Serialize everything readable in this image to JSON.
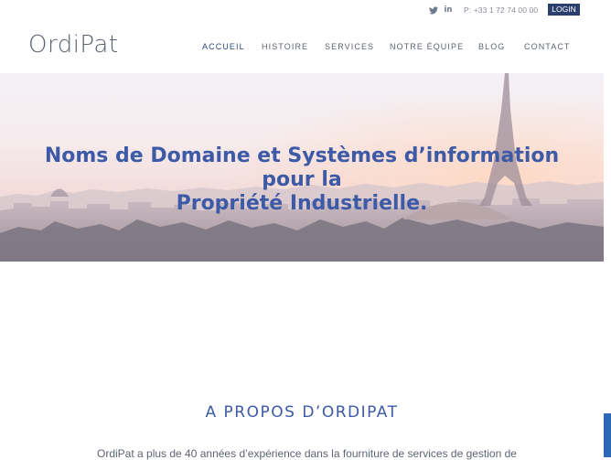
{
  "topbar": {
    "social": [
      "twitter-icon",
      "linkedin-icon"
    ],
    "twitter_glyph": "🐦",
    "linkedin_glyph": "in",
    "phone": "P: +33 1 72 74 00 00",
    "login_label": "LOGIN"
  },
  "logo": "OrdiPat",
  "nav": [
    {
      "label": "ACCUEIL",
      "active": true
    },
    {
      "label": "HISTOIRE",
      "active": false
    },
    {
      "label": "SERVICES",
      "active": false
    },
    {
      "label": "NOTRE ÉQUIPE",
      "active": false
    },
    {
      "label": "BLOG",
      "active": false
    },
    {
      "label": "CONTACT",
      "active": false
    }
  ],
  "hero": {
    "title_line1": "Noms de Domaine et Systèmes d’information pour la",
    "title_line2": "Propriété Industrielle."
  },
  "about": {
    "title": "A PROPOS D’ORDIPAT",
    "text": "OrdiPat a plus de 40 années d’expérience dans la fourniture de services de gestion de"
  },
  "colors": {
    "accent": "#3d5aa7",
    "login_bg": "#2b3f6e",
    "nav_active": "#2b4779",
    "side_tab": "#2d67b5"
  }
}
